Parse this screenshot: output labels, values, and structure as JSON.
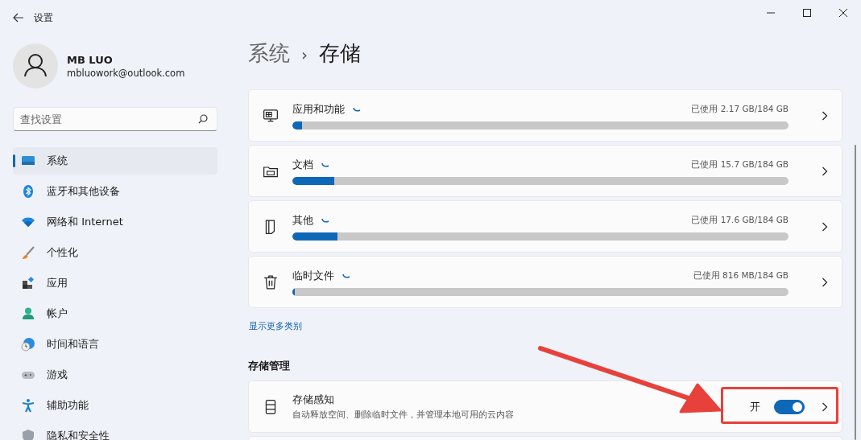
{
  "window": {
    "title": "设置"
  },
  "user": {
    "name": "MB LUO",
    "email": "mbluowork@outlook.com"
  },
  "search": {
    "placeholder": "查找设置"
  },
  "sidebar": {
    "items": [
      {
        "label": "系统",
        "selected": true
      },
      {
        "label": "蓝牙和其他设备",
        "selected": false
      },
      {
        "label": "网络和 Internet",
        "selected": false
      },
      {
        "label": "个性化",
        "selected": false
      },
      {
        "label": "应用",
        "selected": false
      },
      {
        "label": "帐户",
        "selected": false
      },
      {
        "label": "时间和语言",
        "selected": false
      },
      {
        "label": "游戏",
        "selected": false
      },
      {
        "label": "辅助功能",
        "selected": false
      },
      {
        "label": "隐私和安全性",
        "selected": false
      }
    ]
  },
  "breadcrumb": [
    "系统",
    "›",
    "存储"
  ],
  "categories": [
    {
      "label": "应用和功能",
      "usage": "已使用 2.17 GB/184 GB",
      "level": 0.02
    },
    {
      "label": "文档",
      "usage": "已使用 15.7 GB/184 GB",
      "level": 0.084
    },
    {
      "label": "其他",
      "usage": "已使用 17.6 GB/184 GB",
      "level": 0.091
    },
    {
      "label": "临时文件",
      "usage": "已使用 816 MB/184 GB",
      "level": 0.005
    }
  ],
  "show_more": "显示更多类别",
  "section_title": "存储管理",
  "storage_sense": {
    "title": "存储感知",
    "description": "自动释放空间、删除临时文件，并管理本地可用的云内容",
    "state_label": "开",
    "on": true
  }
}
